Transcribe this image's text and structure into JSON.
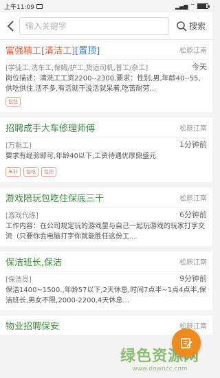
{
  "status": {
    "time": "上午11:09",
    "battery_level": 0.85
  },
  "search": {
    "placeholder": "输入关键字",
    "button_label": "搜索"
  },
  "jobs": [
    {
      "title": "富强精工",
      "tag": "[清洁工]",
      "top": "[置顶]",
      "location": "松原江南",
      "category": "[学徒工,洗车工,保姆/护工,货运司机,普工/杂工]",
      "time": "今天",
      "description": "岗位描述：清洗工工资2200--2300,要求：性别,男,年龄40--55,供吃供住,活不多,有活就干没活就呆着,吃苦耐劳...",
      "badges": [
        "包住"
      ]
    },
    {
      "title": "招聘成手大车修理师傅",
      "location": "松原江南",
      "category": "[万能工]",
      "time": "1分钟前",
      "description": "要求有经验即可,年龄40以下,工资待遇优厚鼎盛元",
      "badges": [
        "车补",
        "包吃",
        "包住"
      ]
    },
    {
      "title": "游戏陪玩包吃住保底三千",
      "location": "松原江南",
      "category": "[游戏代练]",
      "time": "6分钟前",
      "description": "工作内容：在公司规定玩的游戏里与自己一起玩游戏的玩家打字交流（只要你会电脑打字你就能胜任这份工...",
      "badges": []
    },
    {
      "title": "保洁班长,保洁",
      "location": "松原江南",
      "category": "[保洁员]",
      "time": "9分钟前",
      "description": "保洁1400~1500.,年龄57以下,2天休息,时间7点半~1点4点半,保洁班长,男女不限,2000-2200,4天休息...",
      "badges": []
    },
    {
      "title": "物业招聘保安",
      "location": "松原江南",
      "category": "",
      "time": "",
      "description": "",
      "badges": []
    }
  ],
  "watermark": {
    "line1": "绿色资源网",
    "line2": "www.downcc.com"
  },
  "colors": {
    "accent_green": "#3e8e3e",
    "accent_red": "#e45c3a",
    "top_blue": "#3b7bd6",
    "fab_orange": "#f08a1c"
  }
}
